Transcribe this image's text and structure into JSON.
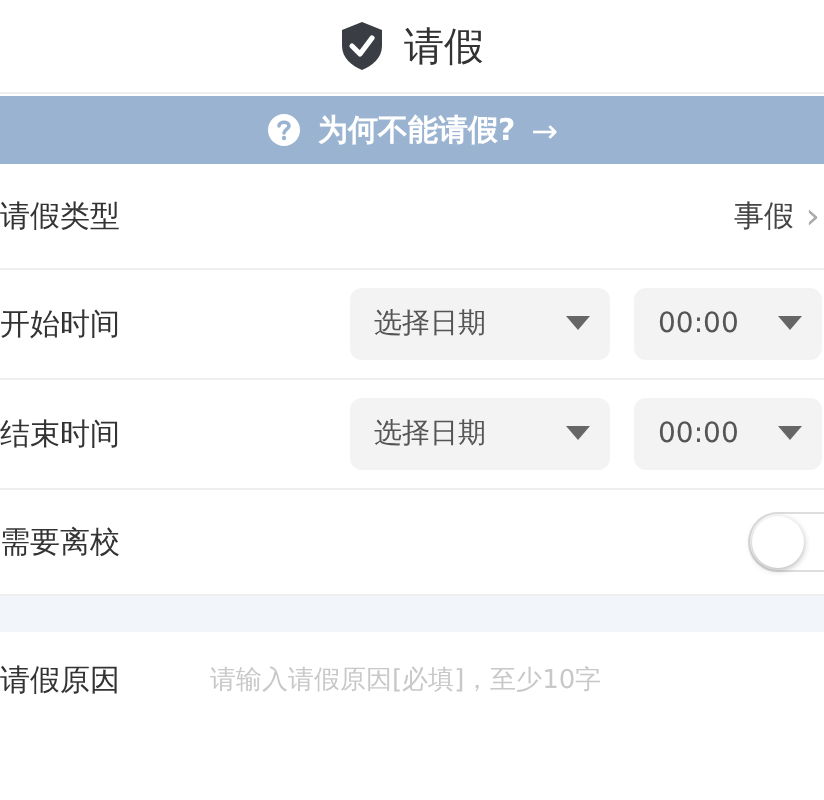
{
  "header": {
    "title": "请假"
  },
  "notice": {
    "text": "为何不能请假?",
    "arrow": "→"
  },
  "form": [
    {
      "kind": "select",
      "label": "请假类型",
      "value": "事假",
      "chevron": "›"
    },
    {
      "kind": "datetime",
      "label": "开始时间",
      "date": "选择日期",
      "time": "00:00"
    },
    {
      "kind": "datetime",
      "label": "结束时间",
      "date": "选择日期",
      "time": "00:00"
    },
    {
      "kind": "toggle",
      "label": "需要离校",
      "on": false
    },
    {
      "kind": "gap"
    },
    {
      "kind": "text",
      "label": "请假原因",
      "placeholder": "请输入请假原因[必填]，至少10字"
    }
  ]
}
